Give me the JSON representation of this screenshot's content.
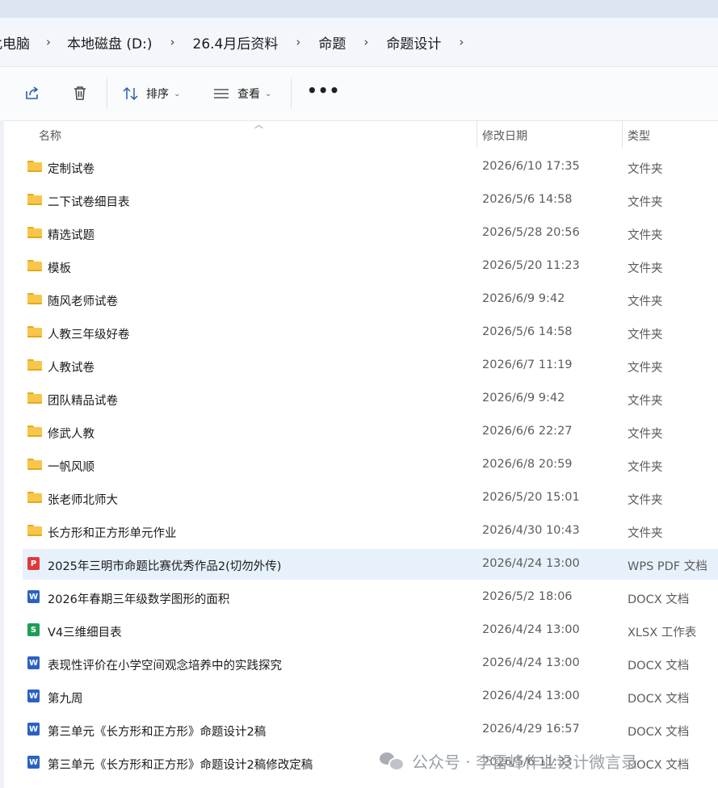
{
  "breadcrumb": {
    "items": [
      "此电脑",
      "本地磁盘 (D:)",
      "26.4月后资料",
      "命题",
      "命题设计"
    ],
    "separator": "›"
  },
  "toolbar": {
    "share_icon": "share-icon",
    "delete_icon": "trash-icon",
    "sort_label": "排序",
    "view_label": "查看",
    "more_label": "•••"
  },
  "columns": {
    "name": "名称",
    "date": "修改日期",
    "type": "类型"
  },
  "files": [
    {
      "name": "定制试卷",
      "date": "2026/6/10 17:35",
      "type": "文件夹",
      "kind": "folder"
    },
    {
      "name": "二下试卷细目表",
      "date": "2026/5/6 14:58",
      "type": "文件夹",
      "kind": "folder"
    },
    {
      "name": "精选试题",
      "date": "2026/5/28 20:56",
      "type": "文件夹",
      "kind": "folder"
    },
    {
      "name": "模板",
      "date": "2026/5/20 11:23",
      "type": "文件夹",
      "kind": "folder"
    },
    {
      "name": "随风老师试卷",
      "date": "2026/6/9 9:42",
      "type": "文件夹",
      "kind": "folder"
    },
    {
      "name": "人教三年级好卷",
      "date": "2026/5/6 14:58",
      "type": "文件夹",
      "kind": "folder"
    },
    {
      "name": "人教试卷",
      "date": "2026/6/7 11:19",
      "type": "文件夹",
      "kind": "folder"
    },
    {
      "name": "团队精品试卷",
      "date": "2026/6/9 9:42",
      "type": "文件夹",
      "kind": "folder"
    },
    {
      "name": "修武人教",
      "date": "2026/6/6 22:27",
      "type": "文件夹",
      "kind": "folder"
    },
    {
      "name": "一帆风顺",
      "date": "2026/6/8 20:59",
      "type": "文件夹",
      "kind": "folder"
    },
    {
      "name": "张老师北师大",
      "date": "2026/5/20 15:01",
      "type": "文件夹",
      "kind": "folder"
    },
    {
      "name": "长方形和正方形单元作业",
      "date": "2026/4/30 10:43",
      "type": "文件夹",
      "kind": "folder"
    },
    {
      "name": "2025年三明市命题比赛优秀作品2(切勿外传)",
      "date": "2026/4/24 13:00",
      "type": "WPS PDF 文档",
      "kind": "pdf",
      "selected": true
    },
    {
      "name": "2026年春期三年级数学图形的面积",
      "date": "2026/5/2 18:06",
      "type": "DOCX 文档",
      "kind": "docx"
    },
    {
      "name": "V4三维细目表",
      "date": "2026/4/24 13:00",
      "type": "XLSX 工作表",
      "kind": "xlsx"
    },
    {
      "name": "表现性评价在小学空间观念培养中的实践探究",
      "date": "2026/4/24 13:00",
      "type": "DOCX 文档",
      "kind": "docx"
    },
    {
      "name": "第九周",
      "date": "2026/4/24 13:00",
      "type": "DOCX 文档",
      "kind": "docx"
    },
    {
      "name": "第三单元《长方形和正方形》命题设计2稿",
      "date": "2026/4/29 16:57",
      "type": "DOCX 文档",
      "kind": "docx"
    },
    {
      "name": "第三单元《长方形和正方形》命题设计2稿修改定稿",
      "date": "2026/5/6 11:33",
      "type": "DOCX 文档",
      "kind": "docx"
    }
  ],
  "icon_glyphs": {
    "docx": "W",
    "xlsx": "S",
    "pdf": "P"
  },
  "colors": {
    "selected_row": "#e6f1fb",
    "folder": "#f7c64a",
    "docx": "#2b62c1",
    "xlsx": "#1f9d56",
    "pdf": "#e0383b"
  },
  "watermark": {
    "text": "公众号 · 李雷峰作业设计微言录",
    "logo_icon": "wechat-icon"
  }
}
